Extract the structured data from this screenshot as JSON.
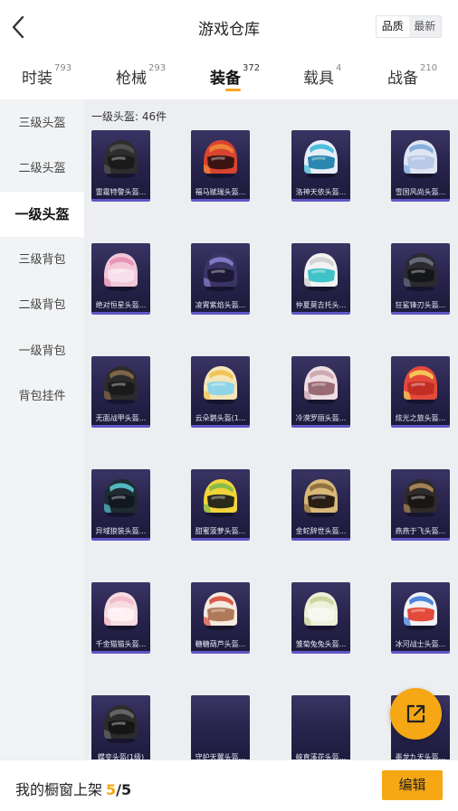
{
  "header": {
    "title": "游戏仓库",
    "sort_options": [
      "品质",
      "最新"
    ]
  },
  "tabs": [
    {
      "label": "时装",
      "count": "793"
    },
    {
      "label": "枪械",
      "count": "293"
    },
    {
      "label": "装备",
      "count": "372"
    },
    {
      "label": "载具",
      "count": "4"
    },
    {
      "label": "战备",
      "count": "210"
    }
  ],
  "sidebar": {
    "items": [
      {
        "label": "三级头盔"
      },
      {
        "label": "二级头盔"
      },
      {
        "label": "一级头盔"
      },
      {
        "label": "三级背包"
      },
      {
        "label": "二级背包"
      },
      {
        "label": "一级背包"
      },
      {
        "label": "背包挂件"
      }
    ]
  },
  "section": {
    "title": "一级头盔: 46件"
  },
  "items": [
    {
      "label": "雷霆特警头盔...",
      "base": "#2d2d2d",
      "accent": "#555555",
      "visor": "#1a1a1a"
    },
    {
      "label": "福马赋瑞头盔...",
      "base": "#d9432f",
      "accent": "#f08a3a",
      "visor": "#3a1410"
    },
    {
      "label": "洛神天依头盔...",
      "base": "#e8eef7",
      "accent": "#3ab8d8",
      "visor": "#2a87b0"
    },
    {
      "label": "雪国风尚头盔...",
      "base": "#dfe6f3",
      "accent": "#7fa7d8",
      "visor": "#b8c9e6"
    },
    {
      "label": "绝对恒星头盔...",
      "base": "#f2c8d8",
      "accent": "#e58fb0",
      "visor": "#f7e0ea"
    },
    {
      "label": "凌霄紫焰头盔...",
      "base": "#3b3566",
      "accent": "#8b7fd0",
      "visor": "#1c1836"
    },
    {
      "label": "仲夏莫吉托头...",
      "base": "#f2f2f2",
      "accent": "#cfcfcf",
      "visor": "#3fc2c8"
    },
    {
      "label": "狂鲨锋刃头盔...",
      "base": "#2a2a30",
      "accent": "#6a6f80",
      "visor": "#15161a"
    },
    {
      "label": "无面战甲头盔...",
      "base": "#2b2b2b",
      "accent": "#8a6a4a",
      "visor": "#1a1a1a"
    },
    {
      "label": "云朵鹅头盔(1...",
      "base": "#f4e6b8",
      "accent": "#f2c04a",
      "visor": "#8fd4e8"
    },
    {
      "label": "冷漠罗丽头盔...",
      "base": "#eedde2",
      "accent": "#c9a4ae",
      "visor": "#9a6a74"
    },
    {
      "label": "炫光之旅头盔...",
      "base": "#e34a3a",
      "accent": "#f7d35a",
      "visor": "#c22d24"
    },
    {
      "label": "异域狼装头盔...",
      "base": "#1f2a33",
      "accent": "#58c6cf",
      "visor": "#111820"
    },
    {
      "label": "甜蜜菠萝头盔...",
      "base": "#f2d43a",
      "accent": "#7bb94a",
      "visor": "#2a2a1a"
    },
    {
      "label": "金蛇辞世头盔...",
      "base": "#d9b879",
      "accent": "#8a6a3a",
      "visor": "#2a1e12"
    },
    {
      "label": "燕燕于飞头盔...",
      "base": "#2e2a2a",
      "accent": "#b08a5a",
      "visor": "#1a1616"
    },
    {
      "label": "千金猫猫头盔...",
      "base": "#f7dce4",
      "accent": "#f2b8c8",
      "visor": "#fff0f4"
    },
    {
      "label": "糖糖葫芦头盔...",
      "base": "#f4eae0",
      "accent": "#d94a3a",
      "visor": "#b07a5a"
    },
    {
      "label": "雏菊兔兔头盔...",
      "base": "#eef0da",
      "accent": "#c8d19a",
      "visor": "#f7f7f0"
    },
    {
      "label": "冰河战士头盔...",
      "base": "#f0f2f6",
      "accent": "#3a7ad8",
      "visor": "#e34a3a"
    },
    {
      "label": "蝶变头盔(1级)",
      "base": "#2b2b2b",
      "accent": "#6a6a6a",
      "visor": "#151515"
    },
    {
      "label": "守护天翼头盔...",
      "base": "",
      "accent": "",
      "visor": ""
    },
    {
      "label": "峡直溪花头盔...",
      "base": "",
      "accent": "",
      "visor": ""
    },
    {
      "label": "墨龙九天头盔...",
      "base": "",
      "accent": "",
      "visor": ""
    }
  ],
  "footer": {
    "shelf_label": "我的橱窗上架",
    "shelf_current": "5",
    "shelf_total": "/5",
    "edit_label": "编辑"
  },
  "colors": {
    "accent": "#f5a714",
    "card_bg": "#26224a",
    "card_border": "#5e56c4"
  },
  "icons": {
    "back": "chevron-left-icon",
    "share": "external-link-icon"
  }
}
